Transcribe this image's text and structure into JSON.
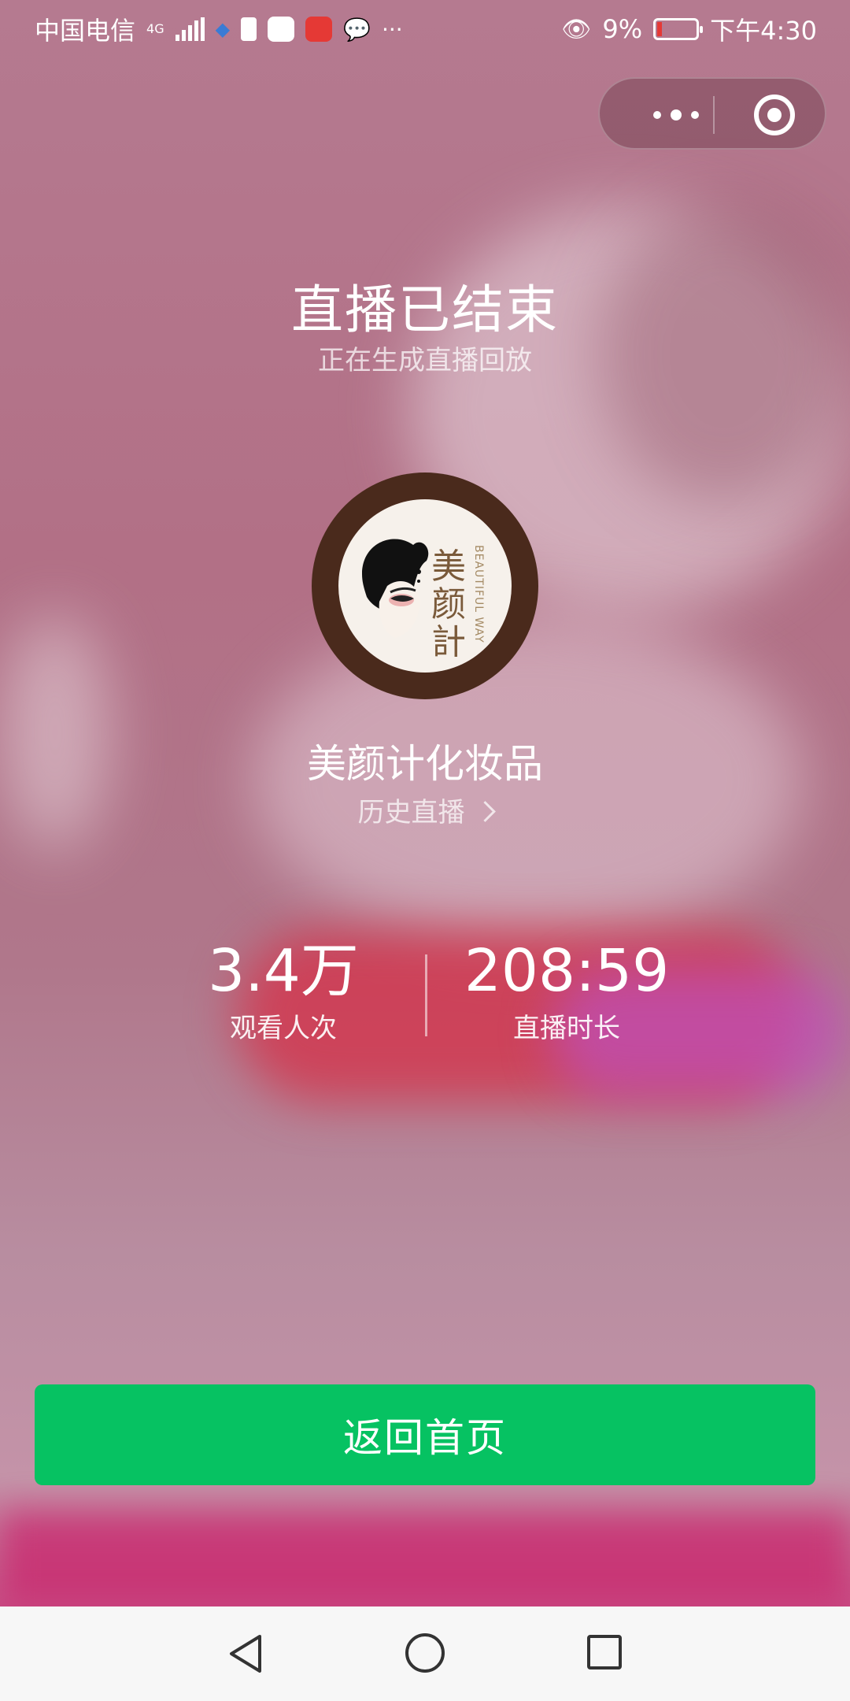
{
  "status_bar": {
    "carrier": "中国电信",
    "network": "4G",
    "battery": "9%",
    "time": "下午4:30"
  },
  "capsule": {
    "more_icon": "more-icon",
    "close_icon": "target-close-icon"
  },
  "live": {
    "title": "直播已结束",
    "subtitle": "正在生成直播回放"
  },
  "streamer": {
    "name": "美颜计化妆品",
    "history_link": "历史直播",
    "logo_text": "美颜計",
    "logo_subtext": "BEAUTIFUL WAY"
  },
  "stats": [
    {
      "value": "3.4万",
      "label": "观看人次"
    },
    {
      "value": "208:59",
      "label": "直播时长"
    }
  ],
  "button": {
    "home_label": "返回首页",
    "color": "#06c262"
  },
  "nav": {
    "back_icon": "back-triangle-icon",
    "home_icon": "home-circle-icon",
    "recent_icon": "recent-square-icon"
  }
}
